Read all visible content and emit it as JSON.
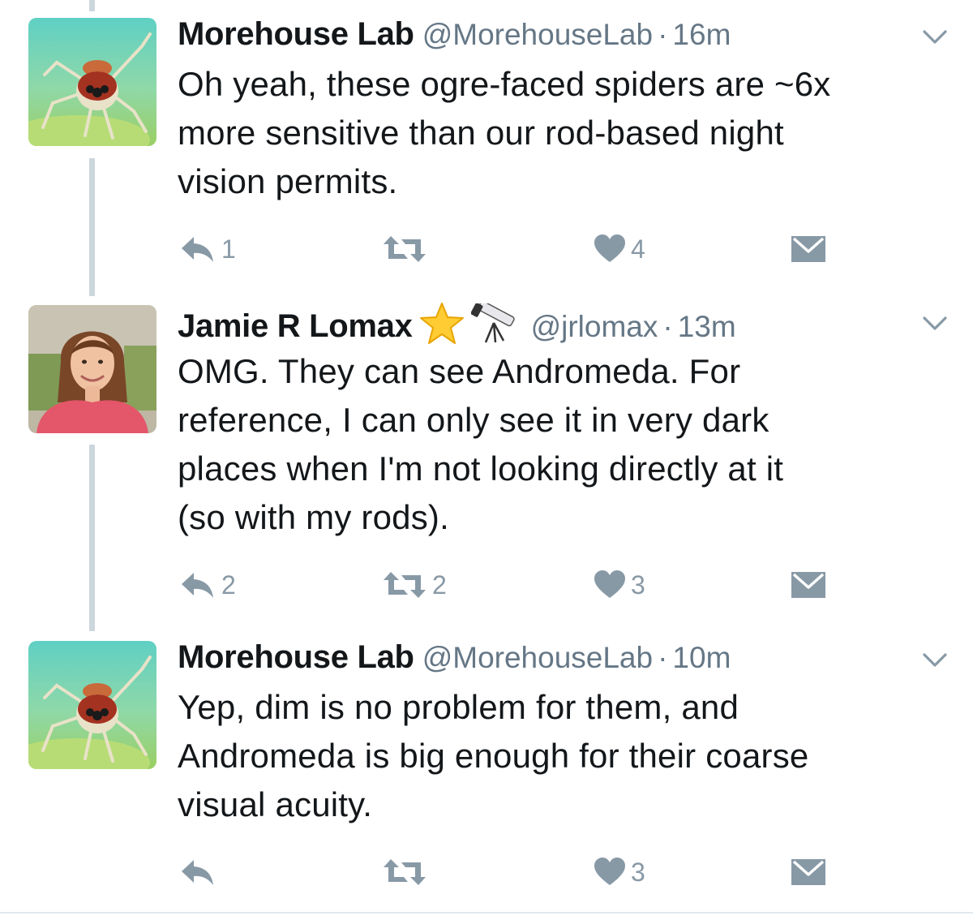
{
  "tweets": [
    {
      "name": "Morehouse Lab",
      "handle": "@MorehouseLab",
      "separator": "·",
      "time": "16m",
      "avatar": "spider-avatar",
      "lines": [
        "Oh yeah, these ogre-faced spiders are ~6x",
        "more sensitive than our rod-based night",
        "vision permits."
      ],
      "replies": "1",
      "retweets": "",
      "likes": "4"
    },
    {
      "name": "Jamie R Lomax",
      "name_emojis": [
        "star-emoji",
        "telescope-emoji"
      ],
      "handle": "@jrlomax",
      "separator": "·",
      "time": "13m",
      "avatar": "person-avatar",
      "lines": [
        "OMG. They can see Andromeda. For",
        "reference, I can only see it in very dark",
        "places when I'm not looking directly at it",
        "(so with my rods)."
      ],
      "replies": "2",
      "retweets": "2",
      "likes": "3"
    },
    {
      "name": "Morehouse Lab",
      "handle": "@MorehouseLab",
      "separator": "·",
      "time": "10m",
      "avatar": "spider-avatar",
      "lines": [
        "Yep, dim is no problem for them, and",
        "Andromeda is big enough for their coarse",
        "visual acuity."
      ],
      "replies": "",
      "retweets": "",
      "likes": "3"
    }
  ],
  "colors": {
    "text": "#14171a",
    "muted": "#657786",
    "icon": "#8899a6",
    "thread_line": "#ccd6dd"
  },
  "icons": {
    "reply": "reply-icon",
    "retweet": "retweet-icon",
    "like": "heart-icon",
    "dm": "envelope-icon",
    "more": "chevron-down-icon"
  }
}
